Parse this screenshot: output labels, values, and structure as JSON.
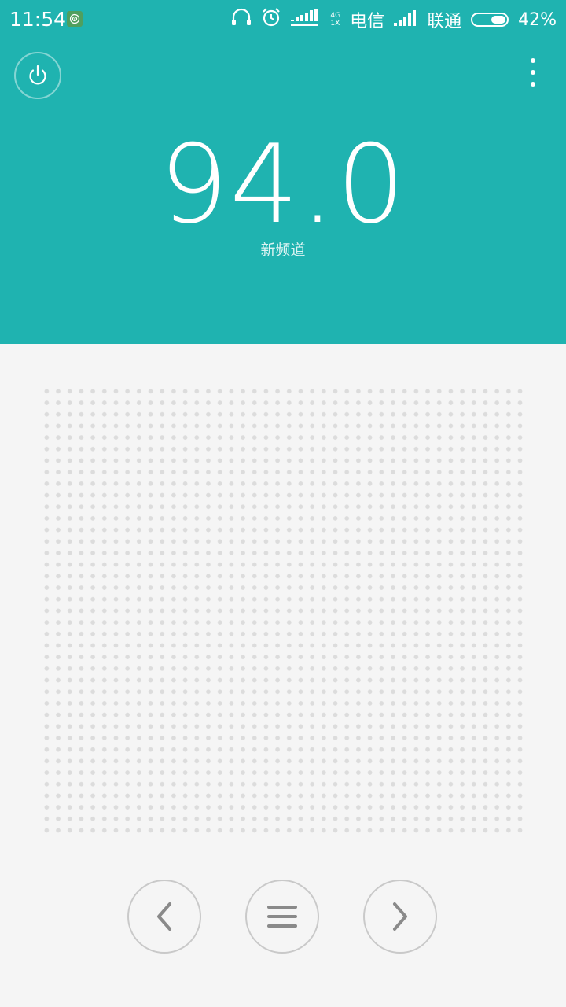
{
  "status_bar": {
    "time": "11:54",
    "net_top": "4G",
    "net_bottom": "1X",
    "carrier1": "电信",
    "carrier2": "联通",
    "battery": "42%"
  },
  "radio": {
    "frequency": "94.0",
    "channel_name": "新频道"
  },
  "icons": {
    "power": "power-icon",
    "overflow": "overflow-menu-icon",
    "prev": "chevron-left-icon",
    "list": "menu-lines-icon",
    "next": "chevron-right-icon",
    "headset": "headphones-icon",
    "alarm": "alarm-clock-icon",
    "hotspot": "hotspot-icon"
  },
  "colors": {
    "accent": "#1fb3b0",
    "background": "#f5f5f5",
    "dots": "#dcdcdc",
    "control_border": "#c9c9c9",
    "control_icon": "#8a8a8a"
  }
}
